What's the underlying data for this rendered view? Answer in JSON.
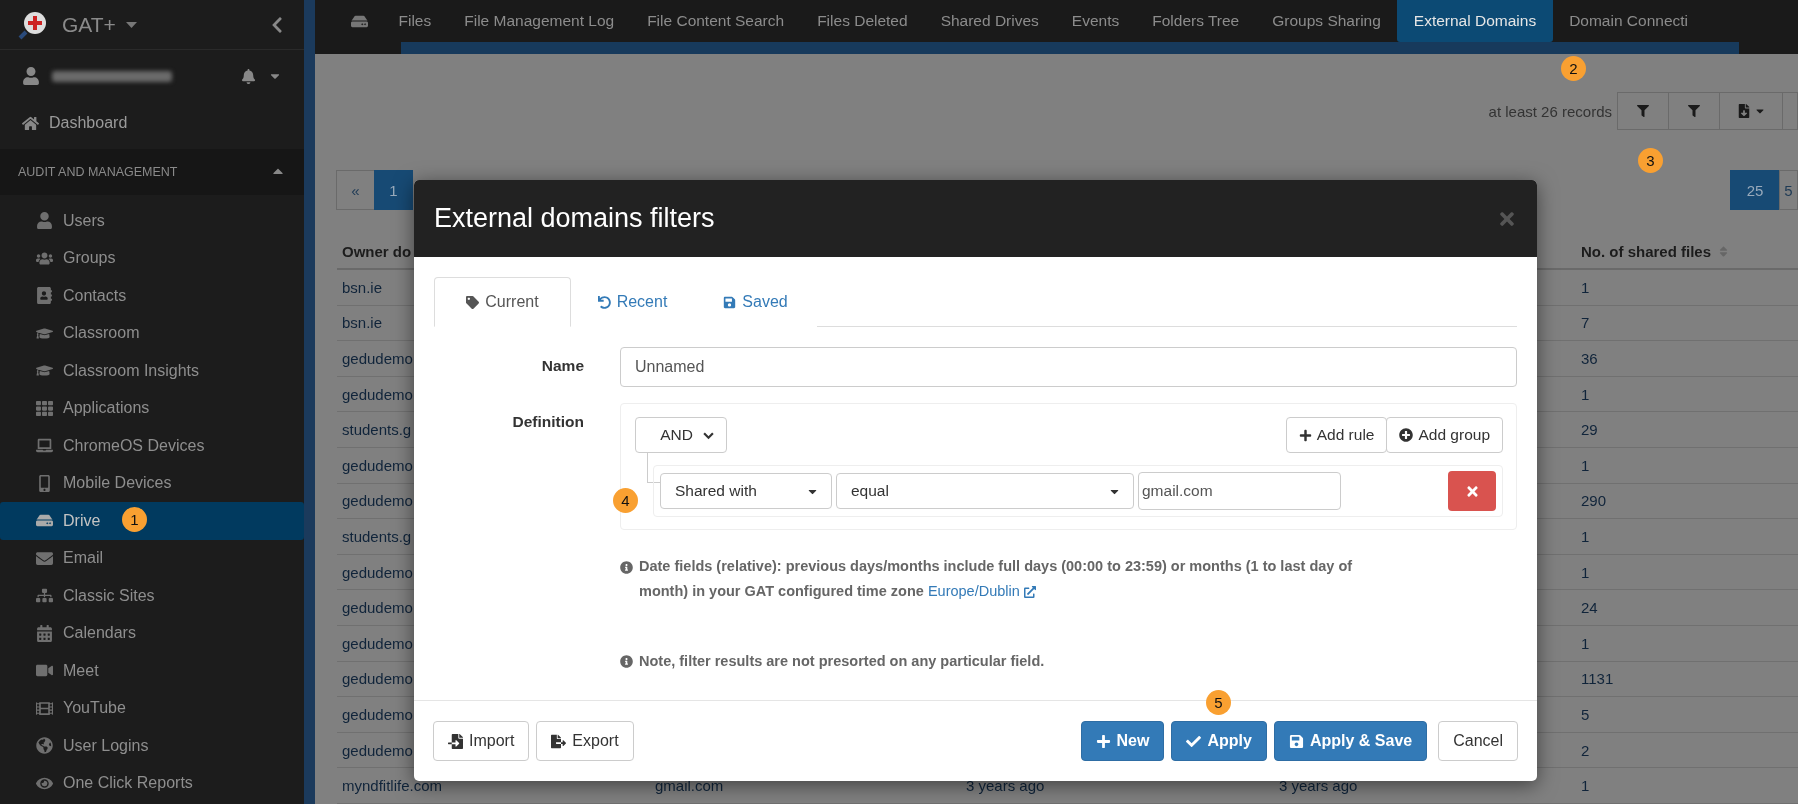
{
  "sidebar": {
    "brand": "GAT+",
    "dashboard": "Dashboard",
    "section": {
      "title": "AUDIT AND MANAGEMENT",
      "expanded": true
    },
    "items": [
      {
        "label": "Users",
        "selected": false
      },
      {
        "label": "Groups",
        "selected": false
      },
      {
        "label": "Contacts",
        "selected": false
      },
      {
        "label": "Classroom",
        "selected": false
      },
      {
        "label": "Classroom Insights",
        "selected": false
      },
      {
        "label": "Applications",
        "selected": false
      },
      {
        "label": "ChromeOS Devices",
        "selected": false
      },
      {
        "label": "Mobile Devices",
        "selected": false
      },
      {
        "label": "Drive",
        "selected": true
      },
      {
        "label": "Email",
        "selected": false
      },
      {
        "label": "Classic Sites",
        "selected": false
      },
      {
        "label": "Calendars",
        "selected": false
      },
      {
        "label": "Meet",
        "selected": false
      },
      {
        "label": "YouTube",
        "selected": false
      },
      {
        "label": "User Logins",
        "selected": false
      },
      {
        "label": "One Click Reports",
        "selected": false
      }
    ]
  },
  "top_nav": {
    "tabs": [
      {
        "label": "Files",
        "selected": false
      },
      {
        "label": "File Management Log",
        "selected": false
      },
      {
        "label": "File Content Search",
        "selected": false
      },
      {
        "label": "Files Deleted",
        "selected": false
      },
      {
        "label": "Shared Drives",
        "selected": false
      },
      {
        "label": "Events",
        "selected": false
      },
      {
        "label": "Folders Tree",
        "selected": false
      },
      {
        "label": "Groups Sharing",
        "selected": false
      },
      {
        "label": "External Domains",
        "selected": true
      },
      {
        "label": "Domain Connecti",
        "selected": false
      }
    ]
  },
  "toolbar": {
    "records": "at least 26 records"
  },
  "pagination": {
    "pages": [
      {
        "label": "«",
        "selected": false
      },
      {
        "label": "1",
        "selected": true
      }
    ],
    "page_sizes": [
      {
        "label": "25",
        "selected": true
      },
      {
        "label": "5",
        "selected": false
      }
    ]
  },
  "table": {
    "columns": [
      {
        "label": "Owner do"
      },
      {
        "label": "No. of shared files",
        "sortable": true
      }
    ],
    "rows": [
      {
        "owner_domain": "bsn.ie",
        "shared_files": "1"
      },
      {
        "owner_domain": "bsn.ie",
        "shared_files": "7"
      },
      {
        "owner_domain": "gedudemo",
        "shared_files": "36"
      },
      {
        "owner_domain": "gedudemo",
        "shared_files": "1"
      },
      {
        "owner_domain": "students.g",
        "shared_files": "29"
      },
      {
        "owner_domain": "gedudemo",
        "shared_files": "1"
      },
      {
        "owner_domain": "gedudemo",
        "shared_files": "290"
      },
      {
        "owner_domain": "students.g",
        "shared_files": "1"
      },
      {
        "owner_domain": "gedudemo",
        "shared_files": "1"
      },
      {
        "owner_domain": "gedudemo",
        "shared_files": "24"
      },
      {
        "owner_domain": "gedudemo",
        "shared_files": "1"
      },
      {
        "owner_domain": "gedudemo",
        "shared_files": "1131"
      },
      {
        "owner_domain": "gedudemo",
        "shared_files": "5"
      },
      {
        "owner_domain": "gedudemo",
        "shared_files": "2"
      },
      {
        "owner_domain": "myndfitlife.com",
        "column_2": "gmail.com",
        "column_3": "3 years ago",
        "column_4": "3 years ago",
        "shared_files": "1"
      }
    ]
  },
  "modal": {
    "title": "External domains filters",
    "tabs": [
      {
        "label": "Current",
        "selected": true
      },
      {
        "label": "Recent",
        "selected": false
      },
      {
        "label": "Saved",
        "selected": false
      }
    ],
    "name": {
      "label": "Name",
      "value": "Unnamed"
    },
    "definition": {
      "label": "Definition",
      "condition": "AND",
      "add_rule": "Add rule",
      "add_group": "Add group",
      "rules": [
        {
          "field": "Shared with",
          "operator": "equal",
          "value": "gmail.com"
        }
      ]
    },
    "info": "Date fields (relative): previous days/months include full days (00:00 to 23:59) or months (1 to last day of month) in your GAT configured time zone",
    "timezone_link": "Europe/Dublin",
    "note": "Note, filter results are not presorted on any particular field.",
    "footer_left": [
      {
        "label": "Import",
        "kind": "default"
      },
      {
        "label": "Export",
        "kind": "default"
      }
    ],
    "footer_right": [
      {
        "label": "New",
        "kind": "primary"
      },
      {
        "label": "Apply",
        "kind": "primary"
      },
      {
        "label": "Apply & Save",
        "kind": "primary"
      },
      {
        "label": "Cancel",
        "kind": "default"
      }
    ]
  },
  "callouts": [
    {
      "label": "1"
    },
    {
      "label": "2"
    },
    {
      "label": "3"
    },
    {
      "label": "4"
    },
    {
      "label": "5"
    }
  ]
}
